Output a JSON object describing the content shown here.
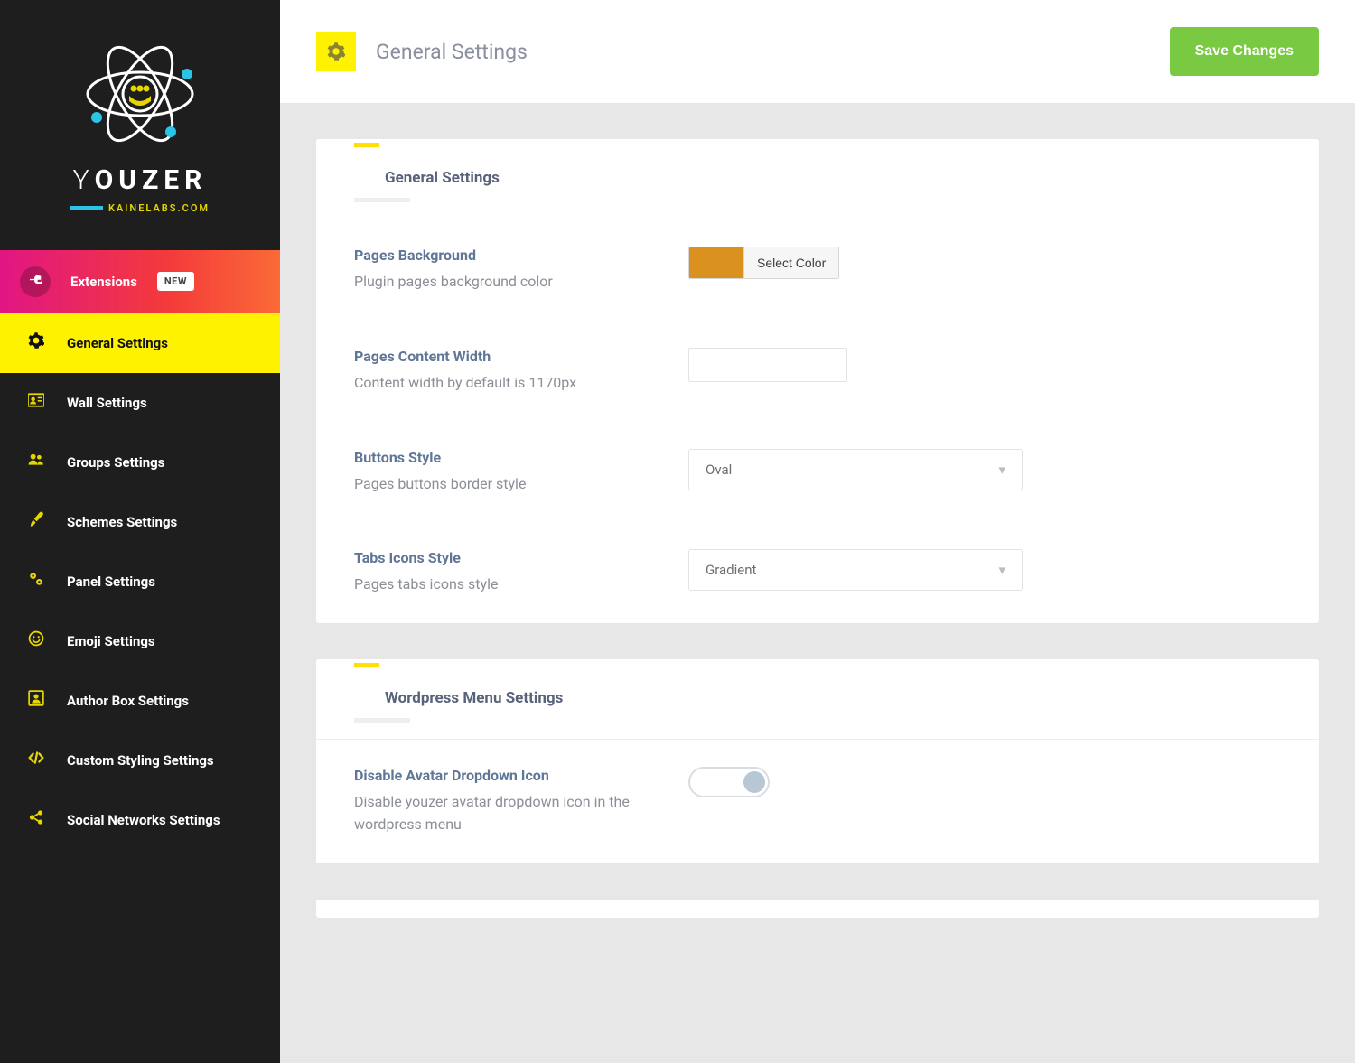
{
  "brand": {
    "name_light": "Y",
    "name_bold": "OUZER",
    "subtitle": "KAINELABS.COM"
  },
  "sidebar": {
    "items": [
      {
        "label": "Extensions",
        "badge": "NEW",
        "kind": "ext"
      },
      {
        "label": "General Settings",
        "kind": "active"
      },
      {
        "label": "Wall Settings"
      },
      {
        "label": "Groups Settings"
      },
      {
        "label": "Schemes Settings"
      },
      {
        "label": "Panel Settings"
      },
      {
        "label": "Emoji Settings"
      },
      {
        "label": "Author Box Settings"
      },
      {
        "label": "Custom Styling Settings"
      },
      {
        "label": "Social Networks Settings"
      }
    ]
  },
  "header": {
    "title": "General Settings",
    "save_label": "Save Changes"
  },
  "sections": {
    "general": {
      "title": "General Settings",
      "pages_bg": {
        "label": "Pages Background",
        "desc": "Plugin pages background color",
        "color": "#da9120",
        "select_color_label": "Select Color"
      },
      "content_width": {
        "label": "Pages Content Width",
        "desc": "Content width by default is 1170px",
        "value": ""
      },
      "buttons_style": {
        "label": "Buttons Style",
        "desc": "Pages buttons border style",
        "value": "Oval"
      },
      "tabs_icons": {
        "label": "Tabs Icons Style",
        "desc": "Pages tabs icons style",
        "value": "Gradient"
      }
    },
    "wp_menu": {
      "title": "Wordpress Menu Settings",
      "disable_avatar": {
        "label": "Disable Avatar Dropdown Icon",
        "desc": "Disable youzer avatar dropdown icon in the wordpress menu",
        "on": false
      }
    }
  }
}
